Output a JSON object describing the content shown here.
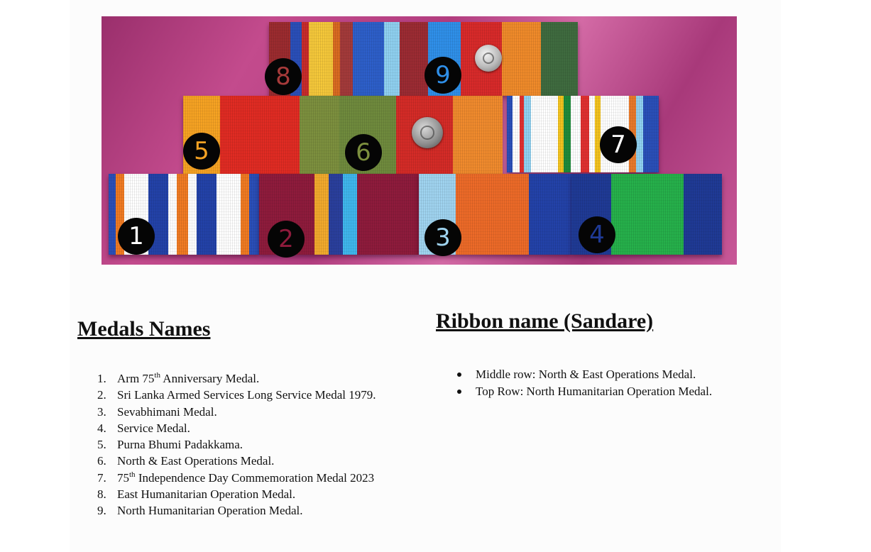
{
  "photo": {
    "alt": "Medal ribbon bars numbered 1 to 9",
    "badges": [
      {
        "label": "1",
        "color": "#ffffff"
      },
      {
        "label": "2",
        "color": "#8e1b3c"
      },
      {
        "label": "3",
        "color": "#9fd3ef"
      },
      {
        "label": "4",
        "color": "#1f3a95"
      },
      {
        "label": "5",
        "color": "#f5a223"
      },
      {
        "label": "6",
        "color": "#7c8f3e"
      },
      {
        "label": "7",
        "color": "#ffffff"
      },
      {
        "label": "8",
        "color": "#a63a3a"
      },
      {
        "label": "9",
        "color": "#2f8fe8"
      }
    ]
  },
  "left_heading": "Medals Names",
  "right_heading": "Ribbon name (Sandare)",
  "medals": [
    {
      "num": "1.",
      "pre": "Arm 75",
      "sup": "th",
      "post": " Anniversary Medal."
    },
    {
      "num": "2.",
      "pre": "Sri Lanka Armed Services Long Service Medal 1979.",
      "sup": "",
      "post": ""
    },
    {
      "num": "3.",
      "pre": "Sevabhimani Medal.",
      "sup": "",
      "post": ""
    },
    {
      "num": "4.",
      "pre": "Service Medal.",
      "sup": "",
      "post": ""
    },
    {
      "num": "5.",
      "pre": "Purna Bhumi Padakkama.",
      "sup": "",
      "post": ""
    },
    {
      "num": "6.",
      "pre": "North & East Operations Medal.",
      "sup": "",
      "post": ""
    },
    {
      "num": "7.",
      "pre": "75",
      "sup": "th",
      "post": " Independence Day Commemoration Medal 2023"
    },
    {
      "num": "8.",
      "pre": "East Humanitarian Operation Medal.",
      "sup": "",
      "post": ""
    },
    {
      "num": "9.",
      "pre": "North Humanitarian Operation Medal.",
      "sup": "",
      "post": ""
    }
  ],
  "ribbon_notes": [
    "Middle row:  North & East Operations Medal.",
    "Top Row: North Humanitarian Operation Medal."
  ]
}
